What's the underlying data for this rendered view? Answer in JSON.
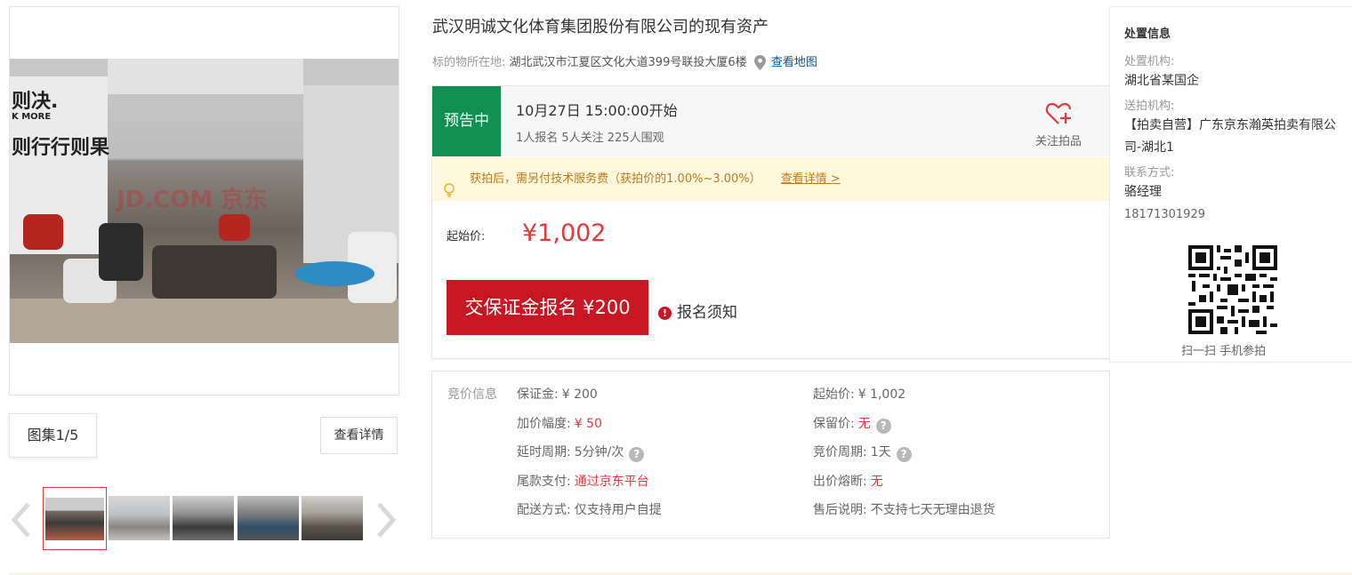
{
  "gallery": {
    "album_label": "图集1/5",
    "detail_button": "查看详情",
    "watermark": "JD.COM 京东",
    "thumbnails": 5,
    "selected_index": 1
  },
  "item": {
    "title": "武汉明诚文化体育集团股份有限公司的现有资产",
    "location_label": "标的物所在地:",
    "address": "湖北武汉市江夏区文化大道399号联投大厦6楼",
    "map_link": "查看地图"
  },
  "auction": {
    "status": "预告中",
    "start_time": "10月27日 15:00:00开始",
    "counts": "1人报名  5人关注  225人围观",
    "follow_label": "关注拍品",
    "notice": "获拍后，需另付技术服务费（获拍价的1.00%~3.00%）",
    "notice_link": "查看详情 >",
    "start_price_label": "起始价:",
    "start_price": "¥1,002",
    "deposit_button": "交保证金报名 ¥200",
    "rules_link": "报名须知",
    "accent_color": "#c81623",
    "status_color": "#109050"
  },
  "bid_info": {
    "title": "竞价信息",
    "left": [
      {
        "label": "保证金:",
        "value": "¥ 200",
        "red": false,
        "help": false
      },
      {
        "label": "加价幅度:",
        "value": "¥ 50",
        "red": true,
        "help": false
      },
      {
        "label": "延时周期:",
        "value": "5分钟/次",
        "red": false,
        "help": true
      },
      {
        "label": "尾款支付:",
        "value": "通过京东平台",
        "red": true,
        "help": false
      },
      {
        "label": "配送方式:",
        "value": "仅支持用户自提",
        "red": false,
        "help": false
      }
    ],
    "right": [
      {
        "label": "起始价:",
        "value": "¥ 1,002",
        "red": false,
        "help": false
      },
      {
        "label": "保留价:",
        "value": "无",
        "red": true,
        "help": true
      },
      {
        "label": "竞价周期:",
        "value": "1天",
        "red": false,
        "help": true
      },
      {
        "label": "出价熔断:",
        "value": "无",
        "red": true,
        "help": false
      },
      {
        "label": "售后说明:",
        "value": "不支持七天无理由退货",
        "red": false,
        "help": false
      }
    ]
  },
  "disposal": {
    "title": "处置信息",
    "org_label": "处置机构:",
    "org": "湖北省某国企",
    "sender_label": "送拍机构:",
    "sender": "【拍卖自营】广东京东瀚英拍卖有限公司-湖北1",
    "contact_label": "联系方式:",
    "contact_name": "骆经理",
    "phone": "18171301929",
    "qr_caption": "扫一扫 手机参拍"
  }
}
